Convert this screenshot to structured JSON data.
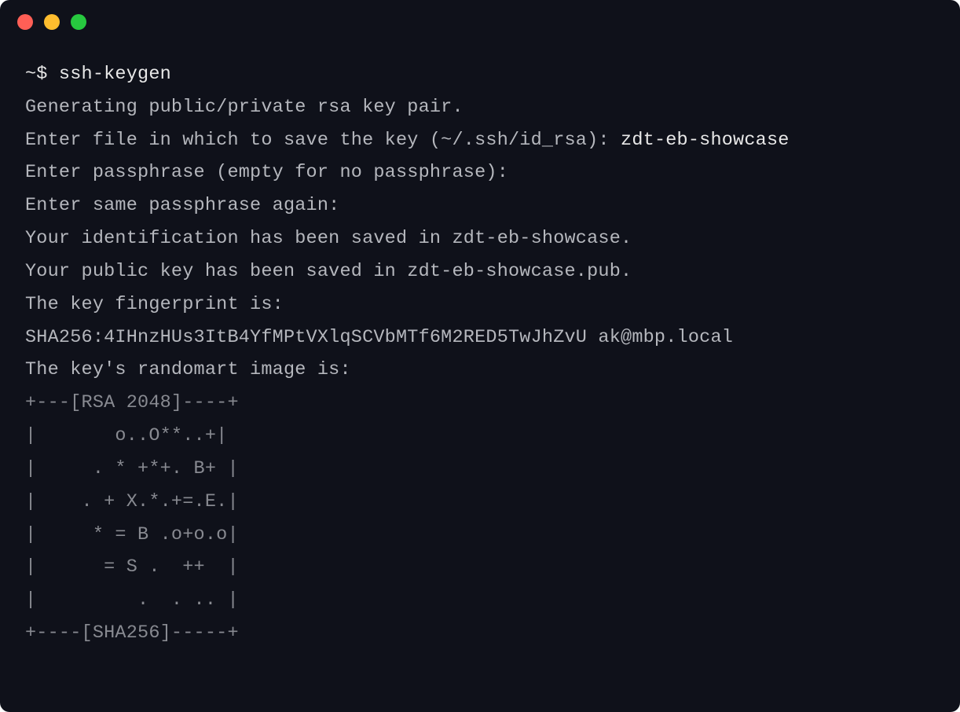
{
  "titlebar": {
    "close": "close",
    "minimize": "minimize",
    "maximize": "maximize"
  },
  "prompt": {
    "symbol": "~$",
    "command": "ssh-keygen"
  },
  "output": {
    "line1": "Generating public/private rsa key pair.",
    "line2_prefix": "Enter file in which to save the key (~/.ssh/id_rsa): ",
    "line2_input": "zdt-eb-showcase",
    "line3": "Enter passphrase (empty for no passphrase):",
    "line4": "Enter same passphrase again:",
    "line5": "Your identification has been saved in zdt-eb-showcase.",
    "line6": "Your public key has been saved in zdt-eb-showcase.pub.",
    "line7": "The key fingerprint is:",
    "line8": "SHA256:4IHnzHUs3ItB4YfMPtVXlqSCVbMTf6M2RED5TwJhZvU ak@mbp.local",
    "line9": "The key's randomart image is:"
  },
  "randomart": {
    "l0": "+---[RSA 2048]----+",
    "l1": "|       o..O**..+|",
    "l2": "|     . * +*+. B+ |",
    "l3": "|    . + X.*.+=.E.|",
    "l4": "|     * = B .o+o.o|",
    "l5": "|      = S .  ++  |",
    "l6": "|         .  . .. |",
    "l7": "+----[SHA256]-----+"
  }
}
